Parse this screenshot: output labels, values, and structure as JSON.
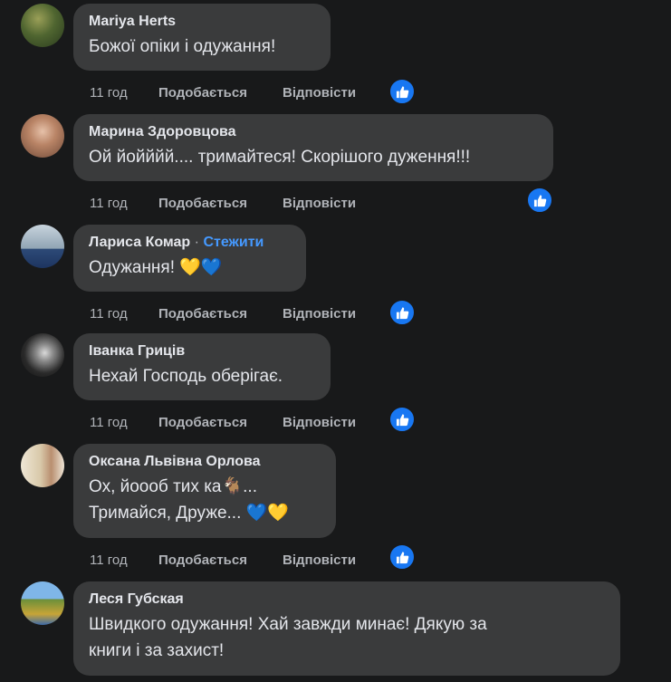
{
  "comments": [
    {
      "name": "Mariya Herts",
      "text_lines": [
        "Божої опіки і одужання!"
      ],
      "time": "11 год",
      "like_label": "Подобається",
      "reply_label": "Відповісти"
    },
    {
      "name": "Марина Здоровцова",
      "text_lines": [
        "Ой йойййй.... тримайтеся! Скорішого дуження!!!"
      ],
      "time": "11 год",
      "like_label": "Подобається",
      "reply_label": "Відповісти"
    },
    {
      "name": "Лариса Комар",
      "follow_label": "Стежити",
      "text_lines": [
        "Одужання! 💛💙"
      ],
      "time": "11 год",
      "like_label": "Подобається",
      "reply_label": "Відповісти"
    },
    {
      "name": "Іванка Гриців",
      "text_lines": [
        "Нехай Господь оберігає."
      ],
      "time": "11 год",
      "like_label": "Подобається",
      "reply_label": "Відповісти"
    },
    {
      "name": "Оксана Львівна Орлова",
      "text_lines": [
        "Ох, йоооб тих ка🐐...",
        "Тримайся, Друже... 💙💛"
      ],
      "time": "11 год",
      "like_label": "Подобається",
      "reply_label": "Відповісти"
    },
    {
      "name": "Леся Губская",
      "text_lines": [
        "Швидкого одужання! Хай завжди минає! Дякую за",
        "книги і за захист!"
      ]
    }
  ],
  "colors": {
    "background": "#18191a",
    "bubble": "#3a3b3c",
    "primary_text": "#e4e6eb",
    "secondary_text": "#b0b3b8",
    "follow_link": "#4599ff",
    "like_reaction": "#1877f2"
  },
  "icons": {
    "reaction": "thumbs-up-icon"
  }
}
